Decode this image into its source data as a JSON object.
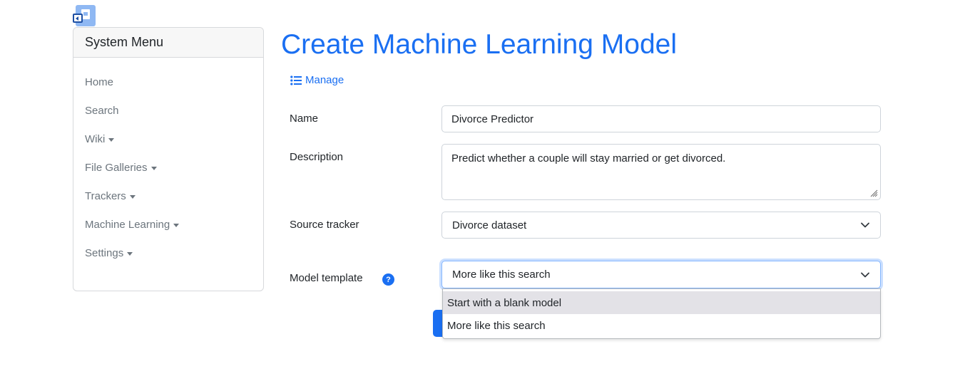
{
  "sidebar": {
    "title": "System Menu",
    "items": [
      {
        "label": "Home",
        "has_caret": false
      },
      {
        "label": "Search",
        "has_caret": false
      },
      {
        "label": "Wiki",
        "has_caret": true
      },
      {
        "label": "File Galleries",
        "has_caret": true
      },
      {
        "label": "Trackers",
        "has_caret": true
      },
      {
        "label": "Machine Learning",
        "has_caret": true
      },
      {
        "label": "Settings",
        "has_caret": true
      }
    ]
  },
  "main": {
    "title": "Create Machine Learning Model",
    "manage_link": "Manage",
    "form": {
      "name_label": "Name",
      "name_value": "Divorce Predictor",
      "description_label": "Description",
      "description_value": "Predict whether a couple will stay married or get divorced.",
      "source_tracker_label": "Source tracker",
      "source_tracker_value": "Divorce dataset",
      "model_template_label": "Model template",
      "model_template_value": "More like this search",
      "model_template_options": [
        "Start with a blank model",
        "More like this search"
      ],
      "help_icon": "?"
    }
  },
  "colors": {
    "accent": "#1a6ff2",
    "muted_text": "#6c757d",
    "option_highlight": "#e3e2e7"
  },
  "icons": {
    "corner": "toggle-panel-icon",
    "manage": "list-icon",
    "help": "question-circle-icon",
    "select": "chevron-down-icon",
    "menu_item": "caret-down-icon"
  }
}
